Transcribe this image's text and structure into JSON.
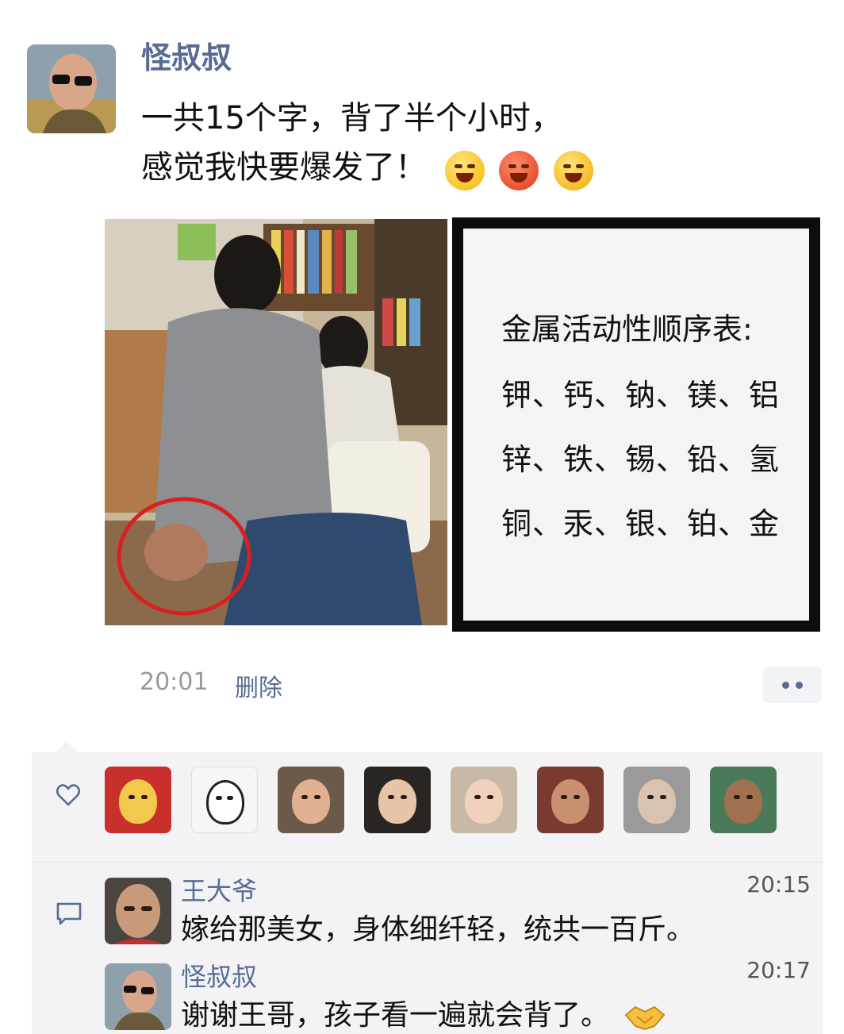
{
  "post": {
    "author": "怪叔叔",
    "line1": "一共15个字，背了半个小时，",
    "line2": "感觉我快要爆发了！",
    "emojis": [
      "tears-laugh-emoji",
      "angry-emoji",
      "mad-emoji"
    ],
    "time": "20:01",
    "delete_label": "删除"
  },
  "card": {
    "title": "金属活动性顺序表:",
    "rows": [
      "钾、钙、钠、镁、铝",
      "锌、铁、锡、铅、氢",
      "铜、汞、银、铂、金"
    ]
  },
  "likes": {
    "icon": "heart-icon",
    "count_avatars": 8
  },
  "comments": [
    {
      "name": "王大爷",
      "time": "20:15",
      "text": "嫁给那美女，身体细纤轻，统共一百斤。"
    },
    {
      "name": "怪叔叔",
      "time": "20:17",
      "text": "谢谢王哥，孩子看一遍就会背了。"
    }
  ],
  "colors": {
    "link": "#576b95",
    "panel_bg": "#f3f3f5"
  }
}
